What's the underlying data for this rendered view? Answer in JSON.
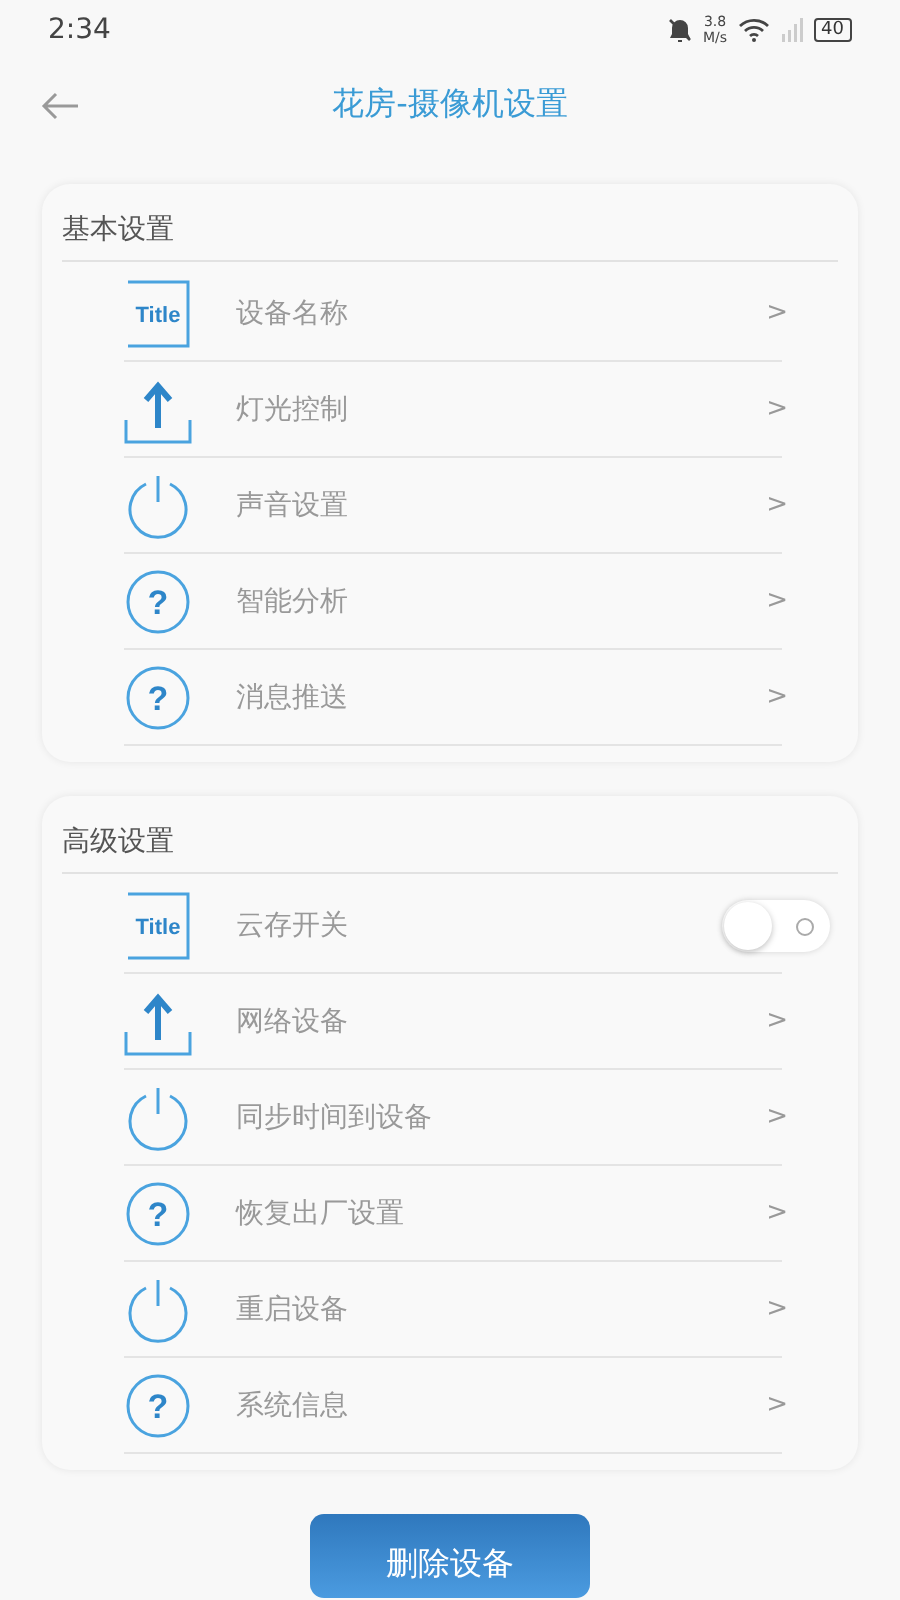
{
  "status_bar": {
    "time": "2:34",
    "speed": "3.8",
    "speed_unit": "M/s",
    "battery": "40"
  },
  "header": {
    "title": "花房-摄像机设置"
  },
  "sections": [
    {
      "title": "基本设置",
      "items": [
        {
          "kind": "link",
          "icon": {
            "kind": "title",
            "text": "Title"
          },
          "label": "设备名称",
          "chevron": ">"
        },
        {
          "kind": "link",
          "icon": {
            "kind": "upload"
          },
          "label": "灯光控制",
          "chevron": ">"
        },
        {
          "kind": "link",
          "icon": {
            "kind": "power"
          },
          "label": "声音设置",
          "chevron": ">"
        },
        {
          "kind": "link",
          "icon": {
            "kind": "help",
            "text": "?"
          },
          "label": "智能分析",
          "chevron": ">"
        },
        {
          "kind": "link",
          "icon": {
            "kind": "help",
            "text": "?"
          },
          "label": "消息推送",
          "chevron": ">"
        }
      ]
    },
    {
      "title": "高级设置",
      "items": [
        {
          "kind": "switch",
          "icon": {
            "kind": "title",
            "text": "Title"
          },
          "label": "云存开关",
          "on": false
        },
        {
          "kind": "link",
          "icon": {
            "kind": "upload"
          },
          "label": "网络设备",
          "chevron": ">"
        },
        {
          "kind": "link",
          "icon": {
            "kind": "power"
          },
          "label": "同步时间到设备",
          "chevron": ">"
        },
        {
          "kind": "link",
          "icon": {
            "kind": "help",
            "text": "?"
          },
          "label": "恢复出厂设置",
          "chevron": ">"
        },
        {
          "kind": "link",
          "icon": {
            "kind": "power"
          },
          "label": "重启设备",
          "chevron": ">"
        },
        {
          "kind": "link",
          "icon": {
            "kind": "help",
            "text": "?"
          },
          "label": "系统信息",
          "chevron": ">"
        }
      ]
    }
  ],
  "delete_button": "删除设备"
}
